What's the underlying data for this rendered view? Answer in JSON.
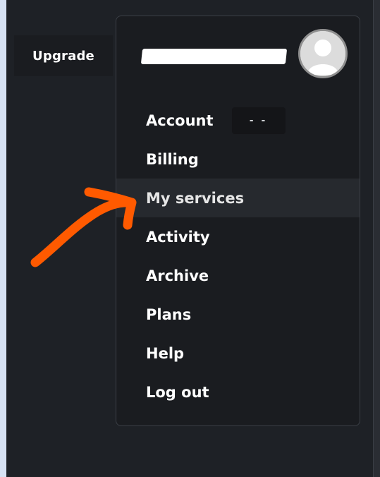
{
  "header": {
    "upgrade_label": "Upgrade",
    "email": "",
    "avatar_icon": "user-avatar-icon"
  },
  "menu": {
    "items": [
      {
        "label": "Account",
        "badge": "- -"
      },
      {
        "label": "Billing"
      },
      {
        "label": "My services"
      },
      {
        "label": "Activity"
      },
      {
        "label": "Archive"
      },
      {
        "label": "Plans"
      },
      {
        "label": "Help"
      },
      {
        "label": "Log out"
      }
    ]
  },
  "annotation": {
    "arrow_color": "#ff5a00"
  }
}
